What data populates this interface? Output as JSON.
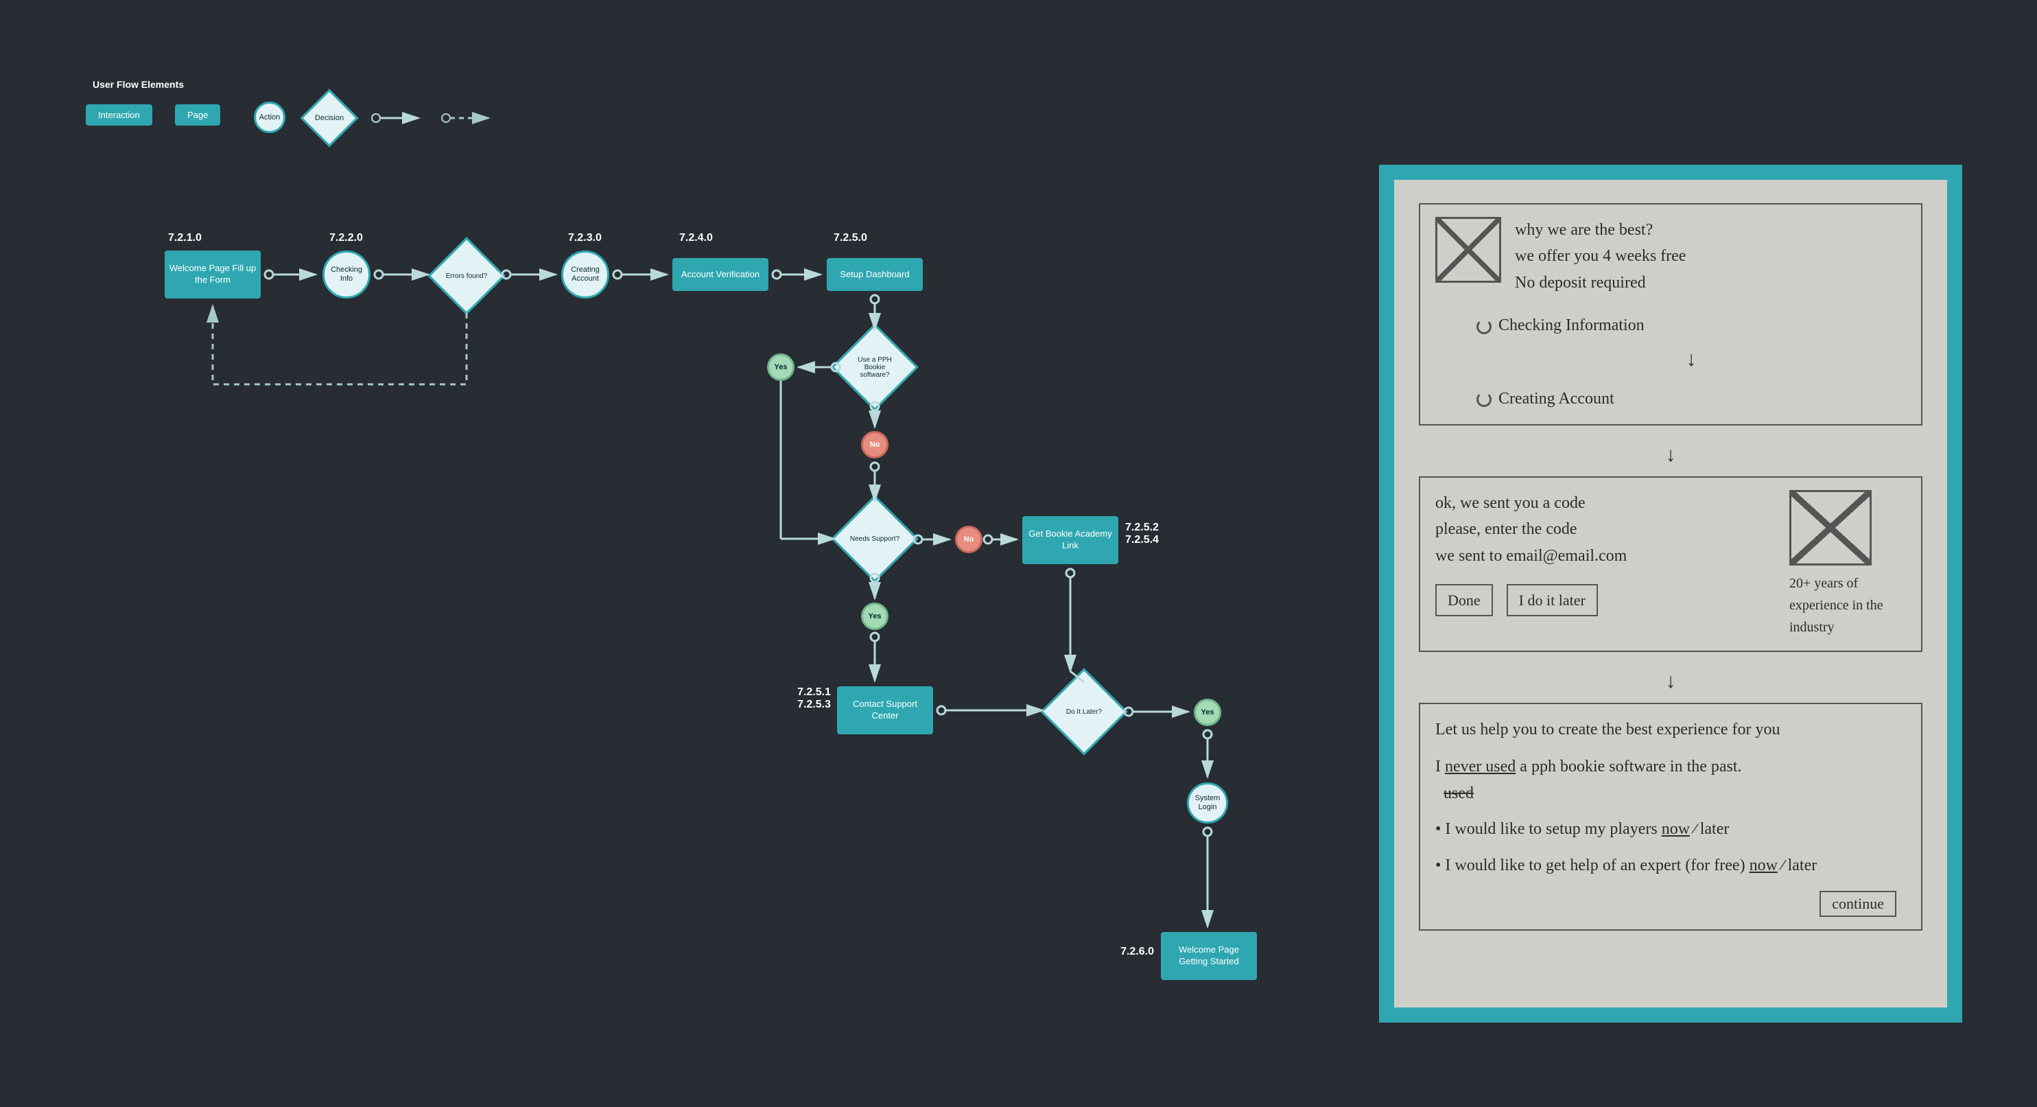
{
  "legend": {
    "title": "User Flow Elements",
    "interaction": "Interaction",
    "page": "Page",
    "action": "Action",
    "decision": "Decision"
  },
  "nodes": {
    "n1": {
      "id": "7.2.1.0",
      "label": "Welcome Page Fill up the Form"
    },
    "n2": {
      "id": "7.2.2.0",
      "label": "Checking Info"
    },
    "d_errors": {
      "label": "Errors found?"
    },
    "n3": {
      "id": "7.2.3.0",
      "label": "Creating Account"
    },
    "n4": {
      "id": "7.2.4.0",
      "label": "Account Verification"
    },
    "n5": {
      "id": "7.2.5.0",
      "label": "Setup Dashboard"
    },
    "d_pph": {
      "label": "Use a PPH Bookie software?"
    },
    "d_support": {
      "label": "Needs Support?"
    },
    "n_sup": {
      "id": "7.2.5.1\n7.2.5.3",
      "label": "Contact Support Center"
    },
    "n_acad": {
      "id": "7.2.5.2\n7.2.5.4",
      "label": "Get Bookie Academy Link"
    },
    "d_later": {
      "label": "Do It Later?"
    },
    "a_login": {
      "label": "System Login"
    },
    "n6": {
      "id": "7.2.6.0",
      "label": "Welcome Page Getting Started"
    },
    "yes": "Yes",
    "no": "No"
  },
  "wireframe": {
    "card1": {
      "line1": "why we are the best?",
      "line2": "we offer you 4 weeks free",
      "line3": "No deposit required",
      "step1": "Checking Information",
      "step2": "Creating Account"
    },
    "card2": {
      "line1": "ok, we sent you a code",
      "line2": "please, enter the code",
      "line3": "we sent to email@email.com",
      "btn1": "Done",
      "btn2": "I do it later",
      "side": "20+ years of experience in the industry"
    },
    "card3": {
      "intro": "Let us help you to create the best experience for you",
      "b1a": "never used",
      "b1b": "used",
      "b1c": "a pph bookie software in the past.",
      "pre": "I",
      "b2": "I would like to setup my players",
      "now": "now",
      "later": "later",
      "b3": "I would like to get help of an expert (for free)",
      "btn": "continue"
    }
  }
}
